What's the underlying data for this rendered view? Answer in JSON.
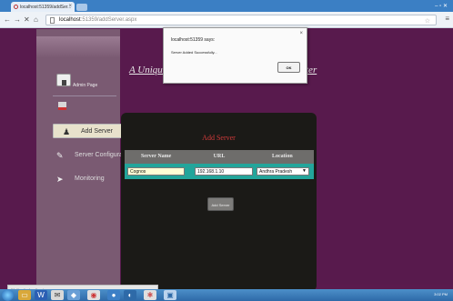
{
  "browser": {
    "tab_title": "localhost:51359/addSer...",
    "tab_close": "×",
    "url_host": "localhost",
    "url_path": ":51359/addServer.aspx",
    "nav_back": "←",
    "nav_forward": "→",
    "nav_stop": "✕",
    "nav_home": "⌂",
    "star": "☆",
    "menu": "≡",
    "window_controls": "–  ▫  ✕"
  },
  "sidebar": {
    "admin_label": "Admin Page",
    "items": [
      {
        "label": "Add Server",
        "active": true,
        "icon": "person-icon"
      },
      {
        "label": "Server Configuration",
        "active": false,
        "icon": "tools-icon"
      },
      {
        "label": "Monitoring",
        "active": false,
        "icon": "monitor-icon"
      }
    ]
  },
  "banner": {
    "left": "A Unique M",
    "right": "ter"
  },
  "panel": {
    "title": "Add Server",
    "columns": [
      "Server Name",
      "URL",
      "Location"
    ],
    "server_name_value": "Cognos",
    "url_value": "192.168.1.10",
    "location_value": "Andhra Pradesh",
    "add_button": "Add Server"
  },
  "dialog": {
    "title": "localhost:51359 says:",
    "message": "Server Added Successfully...",
    "ok_label": "OK",
    "close": "×"
  },
  "status_text": "Waiting for localhost...",
  "tray": {
    "time": "3:02 PM"
  }
}
